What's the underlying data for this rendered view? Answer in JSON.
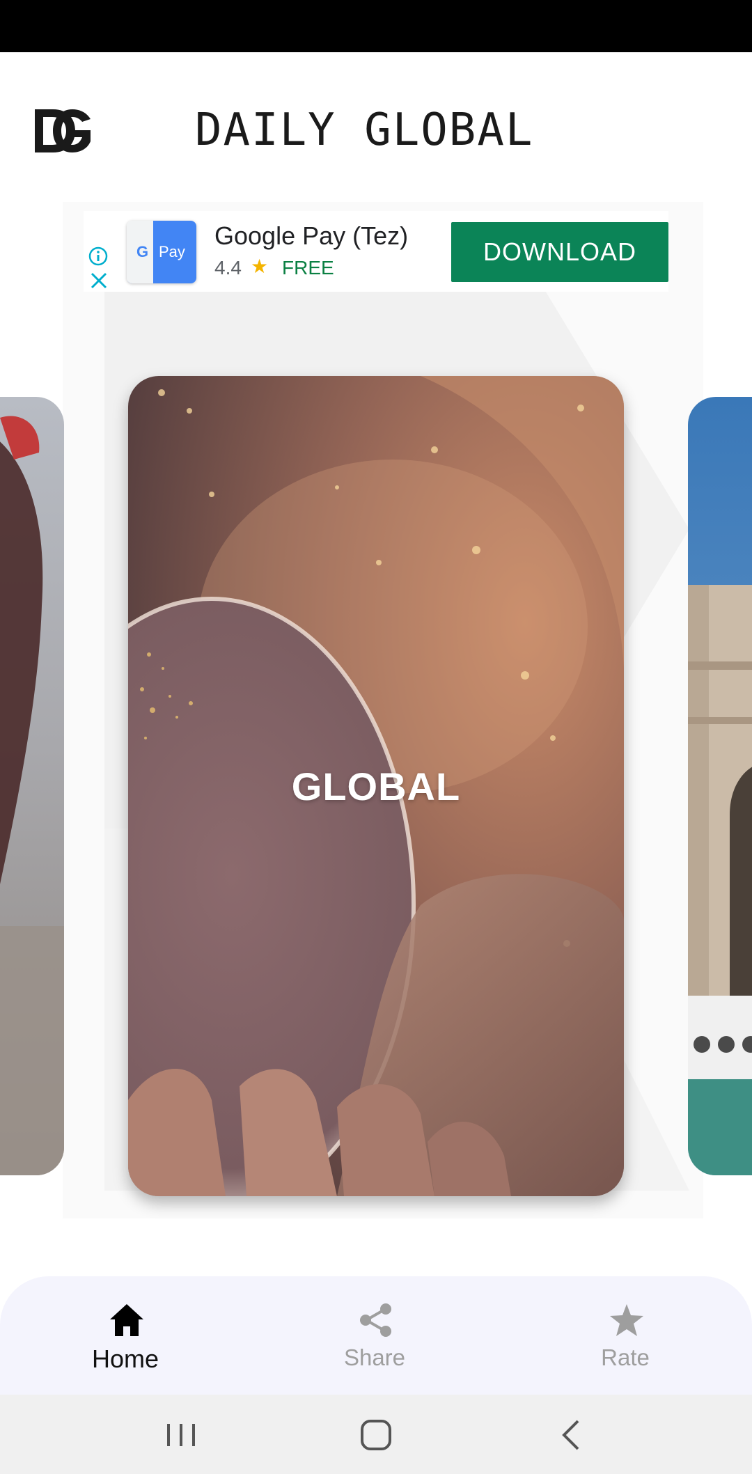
{
  "header": {
    "logo_text": "DG",
    "title": "DAILY GLOBAL"
  },
  "ad": {
    "app_name": "Google Pay (Tez)",
    "rating": "4.4",
    "price": "FREE",
    "cta_label": "DOWNLOAD",
    "icon_text": "Pay",
    "info_icon": "info-icon",
    "close_icon": "close-icon"
  },
  "carousel": {
    "cards": [
      {
        "label": ""
      },
      {
        "label": "GLOBAL"
      },
      {
        "label": ""
      }
    ]
  },
  "bottom_nav": {
    "items": [
      {
        "label": "Home",
        "icon": "home-icon",
        "active": true
      },
      {
        "label": "Share",
        "icon": "share-icon",
        "active": false
      },
      {
        "label": "Rate",
        "icon": "star-icon",
        "active": false
      }
    ]
  },
  "system_nav": {
    "buttons": [
      "recents-icon",
      "home-circle-icon",
      "back-icon"
    ]
  },
  "colors": {
    "cta": "#0b8457",
    "status_bar": "#000000",
    "nav_background": "#f4f4fd",
    "active_nav": "#111111",
    "inactive_nav": "#9e9e9e"
  }
}
